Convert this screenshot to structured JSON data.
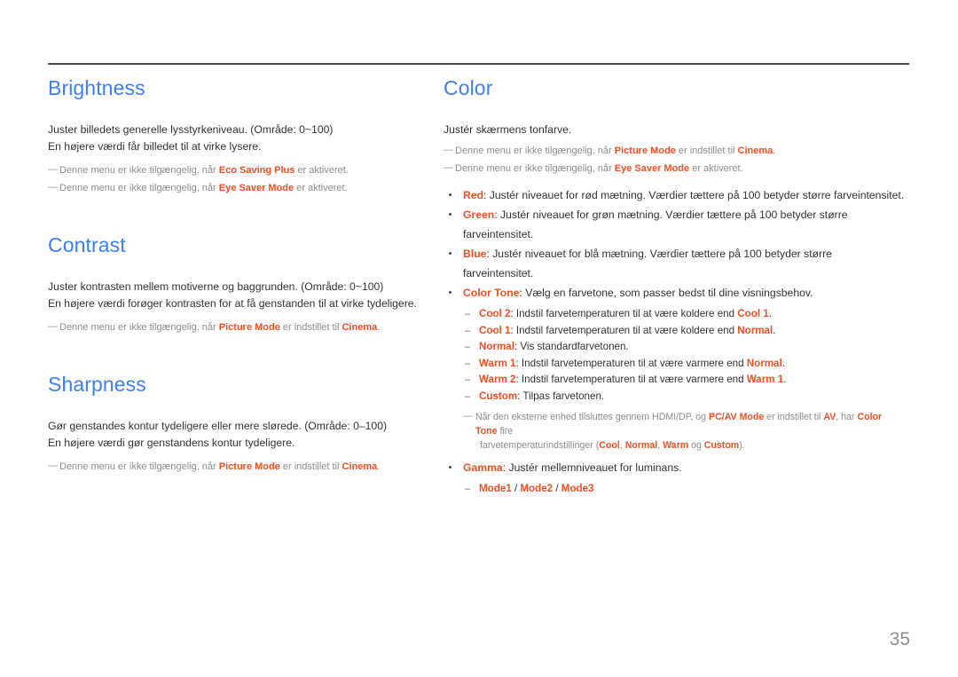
{
  "page": {
    "number": "35",
    "accent_heading_color": "#3d7ff0",
    "accent_highlight_color": "#ef4f23",
    "body_color": "#333333",
    "note_color": "#8c8c8c",
    "note_marker": "―"
  },
  "left_column": {
    "sections": [
      {
        "title": "Brightness",
        "lines": [
          "Juster billedets generelle lysstyrkeniveau. (Område: 0~100)",
          "En højere værdi får billedet til at virke lysere."
        ],
        "notes": [
          {
            "pre": "Denne menu er ikke tilgængelig, når ",
            "term": "Eco Saving Plus",
            "post": " er aktiveret."
          },
          {
            "pre": "Denne menu er ikke tilgængelig, når ",
            "term": "Eye Saver Mode",
            "post": " er aktiveret."
          }
        ]
      },
      {
        "title": "Contrast",
        "lines": [
          "Juster kontrasten mellem motiverne og baggrunden. (Område: 0~100)",
          "En højere værdi forøger kontrasten for at få genstanden til at virke tydeligere."
        ],
        "notes": [
          {
            "pre": "Denne menu er ikke tilgængelig, når ",
            "term": "Picture Mode",
            "mid": " er indstillet til ",
            "term2": "Cinema",
            "post": "."
          }
        ]
      },
      {
        "title": "Sharpness",
        "lines": [
          "Gør genstandes kontur tydeligere eller mere slørede. (Område: 0–100)",
          "En højere værdi gør genstandens kontur tydeligere."
        ],
        "notes": [
          {
            "pre": "Denne menu er ikke tilgængelig, når ",
            "term": "Picture Mode",
            "mid": " er indstillet til ",
            "term2": "Cinema",
            "post": "."
          }
        ]
      }
    ]
  },
  "right_column": {
    "title": "Color",
    "intro": "Justér skærmens tonfarve.",
    "notes": [
      {
        "pre": "Denne menu er ikke tilgængelig, når ",
        "term": "Picture Mode",
        "mid": " er indstillet til ",
        "term2": "Cinema",
        "post": "."
      },
      {
        "pre": "Denne menu er ikke tilgængelig, når ",
        "term": "Eye Saver Mode",
        "post": " er aktiveret."
      }
    ],
    "bullets": [
      {
        "term": "Red",
        "text": ": Justér niveauet for rød mætning. Værdier tættere på 100 betyder større farveintensitet."
      },
      {
        "term": "Green",
        "text": ": Justér niveauet for grøn mætning. Værdier tættere på 100 betyder større farveintensitet."
      },
      {
        "term": "Blue",
        "text": ": Justér niveauet for blå mætning. Værdier tættere på 100 betyder større farveintensitet."
      },
      {
        "term": "Color Tone",
        "text": ": Vælg en farvetone, som passer bedst til dine visningsbehov."
      }
    ],
    "color_tone_options": [
      {
        "term": "Cool 2",
        "mid": ": Indstil farvetemperaturen til at være koldere end ",
        "ref": "Cool 1",
        "post": "."
      },
      {
        "term": "Cool 1",
        "mid": ": Indstil farvetemperaturen til at være koldere end ",
        "ref": "Normal",
        "post": "."
      },
      {
        "term": "Normal",
        "mid": ": Vis standardfarvetonen.",
        "ref": "",
        "post": ""
      },
      {
        "term": "Warm 1",
        "mid": ": Indstil farvetemperaturen til at være varmere end ",
        "ref": "Normal",
        "post": "."
      },
      {
        "term": "Warm 2",
        "mid": ": Indstil farvetemperaturen til at være varmere end ",
        "ref": "Warm 1",
        "post": "."
      },
      {
        "term": "Custom",
        "mid": ": Tilpas farvetonen.",
        "ref": "",
        "post": ""
      }
    ],
    "av_note": {
      "p1": "Når den eksterne enhed tilsluttes gennem HDMI/DP, og ",
      "t1": "PC/AV Mode",
      "p2": " er indstillet til ",
      "t2": "AV",
      "p3": ", har ",
      "t3": "Color Tone",
      "p4": " fire",
      "line2_pre": "farvetemperaturindstillinger (",
      "o1": "Cool",
      "o_sep1": ", ",
      "o2": "Normal",
      "o_sep2": ", ",
      "o3": "Warm",
      "o_sep3": " og ",
      "o4": "Custom",
      "line2_post": ")."
    },
    "gamma": {
      "term": "Gamma",
      "text": ": Justér mellemniveauet for luminans.",
      "modes": [
        "Mode1",
        "Mode2",
        "Mode3"
      ],
      "mode_separator": " / "
    }
  }
}
